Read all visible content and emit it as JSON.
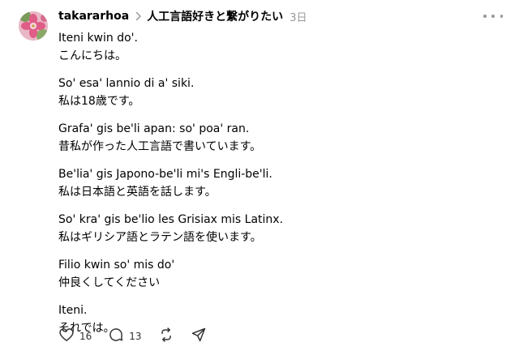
{
  "post": {
    "username": "takararhoa",
    "community": "人工言語好きと繋がりたい",
    "time": "3日",
    "paragraphs": [
      {
        "lines": [
          "Iteni kwin do'.",
          "こんにちは。"
        ]
      },
      {
        "lines": [
          "So' esa' lannio di a' siki.",
          "私は18歳です。"
        ]
      },
      {
        "lines": [
          "Grafa' gis be'li apan: so' poa' ran.",
          "昔私が作った人工言語で書いています。"
        ]
      },
      {
        "lines": [
          "Be'lia' gis Japono-be'li mi's Engli-be'li.",
          "私は日本語と英語を話します。"
        ]
      },
      {
        "lines": [
          "So' kra' gis be'lio les Grisiax mis Latinx.",
          "私はギリシア語とラテン語を使います。"
        ]
      },
      {
        "lines": [
          "Filio kwin so' mis do'",
          "仲良くしてください"
        ]
      },
      {
        "lines": [
          "Iteni.",
          "それでは。"
        ]
      }
    ]
  },
  "actions": {
    "likes": "16",
    "comments": "13"
  },
  "icons": {
    "avatar": "pink-flower-avatar",
    "breadcrumb": "chevron-right-icon",
    "more": "more-icon",
    "like": "heart-icon",
    "comment": "comment-icon",
    "repost": "repost-icon",
    "share": "share-icon"
  },
  "colors": {
    "secondary_text": "#999999",
    "avatar_pink": "#e7a6ba",
    "avatar_green": "#7a9a5a"
  }
}
